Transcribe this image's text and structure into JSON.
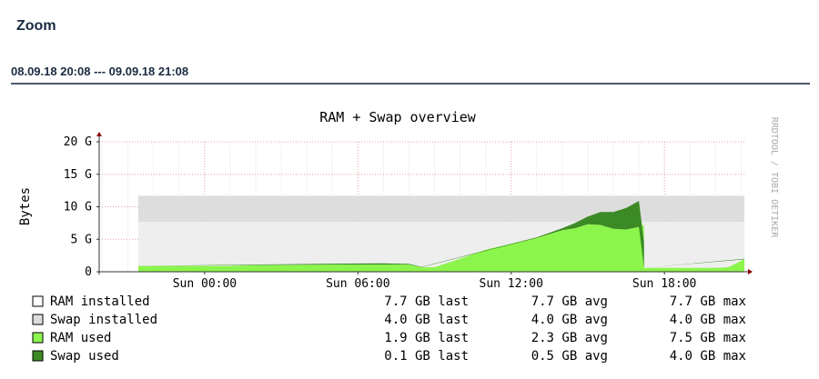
{
  "page": {
    "zoom_label": "Zoom",
    "range": "08.09.18 20:08 --- 09.09.18 21:08"
  },
  "chart_data": {
    "type": "area",
    "title": "RAM + Swap overview",
    "ylabel": "Bytes",
    "watermark": "RRDTOOL / TOBI OETIKER",
    "xlabel": "",
    "x_range_hours": [
      -4.13,
      21.13
    ],
    "ylim_gb": [
      0,
      20
    ],
    "y_ticks": [
      {
        "value": 0,
        "label": "0"
      },
      {
        "value": 5,
        "label": "5 G"
      },
      {
        "value": 10,
        "label": "10 G"
      },
      {
        "value": 15,
        "label": "15 G"
      },
      {
        "value": 20,
        "label": "20 G"
      }
    ],
    "x_ticks": [
      {
        "value": 0,
        "label": "Sun 00:00"
      },
      {
        "value": 6,
        "label": "Sun 06:00"
      },
      {
        "value": 12,
        "label": "Sun 12:00"
      },
      {
        "value": 18,
        "label": "Sun 18:00"
      }
    ],
    "grid": true,
    "installed": {
      "start_hour": -2.6,
      "end_hour": 21.13,
      "ram_gb": 7.7,
      "swap_gb": 4.0
    },
    "ram_used": {
      "hours": [
        -4.13,
        -2.6,
        -2.6,
        0,
        1,
        2,
        3,
        4,
        5,
        6,
        7,
        8,
        8.5,
        9,
        10,
        11,
        12,
        13,
        14,
        14.5,
        15,
        15.5,
        16,
        16.5,
        17,
        17.2,
        17.2,
        19,
        20,
        20.5,
        21.13
      ],
      "values": [
        0,
        0,
        0.9,
        0.9,
        0.9,
        1.0,
        1.0,
        1.05,
        1.1,
        1.1,
        1.1,
        1.1,
        0.7,
        0.7,
        2.0,
        3.4,
        4.3,
        5.2,
        6.4,
        6.7,
        7.3,
        7.2,
        6.6,
        6.5,
        6.9,
        7.2,
        0.6,
        0.6,
        0.6,
        0.7,
        1.9
      ]
    },
    "swap_used": {
      "hours": [
        -4.13,
        -2.6,
        5,
        7,
        8,
        8.5,
        13,
        14,
        14.5,
        15,
        15.5,
        16,
        16.5,
        17,
        17.2,
        17.2,
        21.13
      ],
      "values": [
        0,
        0,
        0.15,
        0.2,
        0.1,
        0.05,
        0.1,
        0.3,
        0.8,
        1.2,
        2.0,
        2.6,
        3.3,
        4.0,
        4.0,
        0.0,
        0.1
      ]
    },
    "legend": [
      {
        "name": "RAM installed",
        "color": "#ffffff",
        "last": "7.7 GB last",
        "avg": "7.7 GB avg",
        "max": "7.7 GB max"
      },
      {
        "name": "Swap installed",
        "color": "#dddddd",
        "last": "4.0 GB last",
        "avg": "4.0 GB avg",
        "max": "4.0 GB max"
      },
      {
        "name": "RAM used",
        "color": "#8cf54c",
        "last": "1.9 GB last",
        "avg": "2.3 GB avg",
        "max": "7.5 GB max"
      },
      {
        "name": "Swap used",
        "color": "#3c8a25",
        "last": "0.1 GB last",
        "avg": "0.5 GB avg",
        "max": "4.0 GB max"
      }
    ],
    "colors": {
      "ram_installed_fill": "#eeeeee",
      "swap_installed_fill": "#dddddd",
      "ram_used": "#8cf54c",
      "swap_used": "#3c8a25",
      "axis": "#333333",
      "arrow": "#8b0000"
    }
  }
}
